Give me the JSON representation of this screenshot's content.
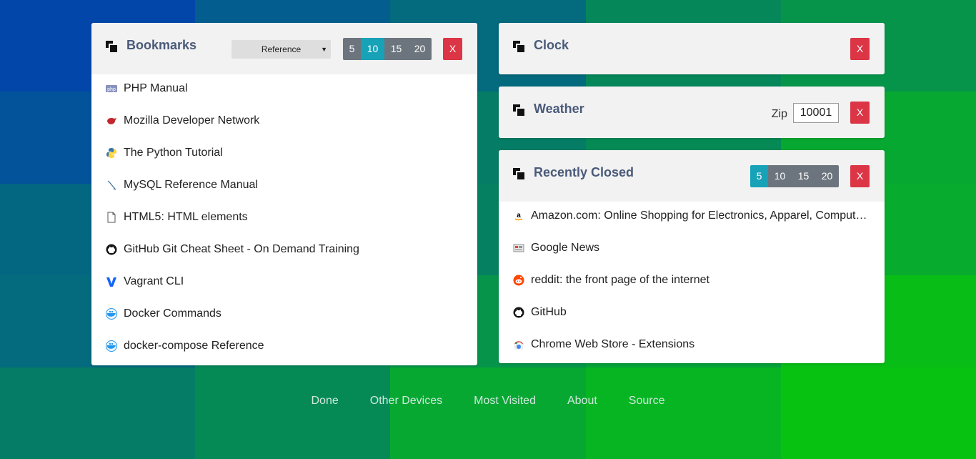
{
  "colors": {
    "close": "#dc3545",
    "count_active": "#17a2b8",
    "count_inactive": "#6c757d",
    "header_bg": "#f2f2f2",
    "title": "#4a5a7a"
  },
  "bookmarks": {
    "title": "Bookmarks",
    "folder_select": "Reference",
    "counts": [
      "5",
      "10",
      "15",
      "20"
    ],
    "active_count": "10",
    "close_label": "X",
    "items": [
      {
        "label": "PHP Manual",
        "icon": "php-icon"
      },
      {
        "label": "Mozilla Developer Network",
        "icon": "mozilla-dino-icon"
      },
      {
        "label": "The Python Tutorial",
        "icon": "python-icon"
      },
      {
        "label": "MySQL Reference Manual",
        "icon": "mysql-dolphin-icon"
      },
      {
        "label": "HTML5: HTML elements",
        "icon": "document-icon"
      },
      {
        "label": "GitHub Git Cheat Sheet - On Demand Training",
        "icon": "github-icon"
      },
      {
        "label": "Vagrant CLI",
        "icon": "vagrant-icon"
      },
      {
        "label": "Docker Commands",
        "icon": "docker-icon"
      },
      {
        "label": "docker-compose Reference",
        "icon": "docker-icon"
      }
    ]
  },
  "clock": {
    "title": "Clock",
    "close_label": "X"
  },
  "weather": {
    "title": "Weather",
    "zip_label": "Zip",
    "zip_value": "10001",
    "close_label": "X"
  },
  "recently_closed": {
    "title": "Recently Closed",
    "counts": [
      "5",
      "10",
      "15",
      "20"
    ],
    "active_count": "5",
    "close_label": "X",
    "items": [
      {
        "label": "Amazon.com: Online Shopping for Electronics, Apparel, Computers, Books, DVDs & more",
        "icon": "amazon-icon"
      },
      {
        "label": "Google News",
        "icon": "news-icon"
      },
      {
        "label": "reddit: the front page of the internet",
        "icon": "reddit-icon"
      },
      {
        "label": "GitHub",
        "icon": "github-icon"
      },
      {
        "label": "Chrome Web Store - Extensions",
        "icon": "chrome-web-store-icon"
      }
    ]
  },
  "footer": {
    "links": [
      "Done",
      "Other Devices",
      "Most Visited",
      "About",
      "Source"
    ]
  }
}
